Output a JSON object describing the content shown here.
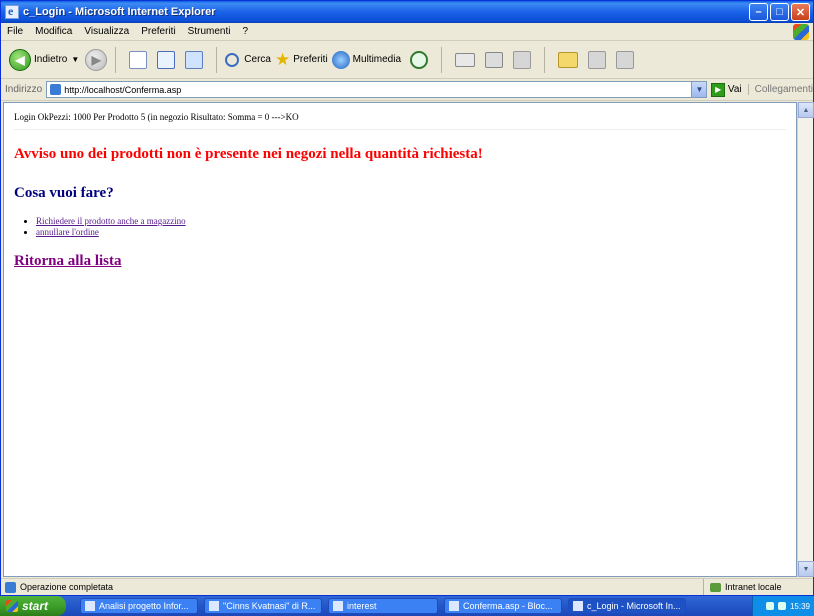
{
  "window": {
    "title": "c_Login - Microsoft Internet Explorer"
  },
  "menu": [
    "File",
    "Modifica",
    "Visualizza",
    "Preferiti",
    "Strumenti",
    "?"
  ],
  "toolbar": {
    "back_label": "Indietro",
    "search_label": "Cerca",
    "favorites_label": "Preferiti",
    "media_label": "Multimedia"
  },
  "address": {
    "label": "Indirizzo",
    "url": "http://localhost/Conferma.asp",
    "go_label": "Vai",
    "links_label": "Collegamenti"
  },
  "page": {
    "log_line": "Login OkPezzi: 1000 Per Prodotto 5 (in negozio Risultato: Somma = 0 --->KO",
    "warning": "Avviso uno dei prodotti non è presente nei negozi nella quantità richiesta!",
    "question": "Cosa vuoi fare?",
    "actions": [
      "Richiedere il prodotto anche a magazzino",
      "annullare l'ordine"
    ],
    "back_link": "Ritorna alla lista"
  },
  "status": {
    "text": "Operazione completata",
    "zone": "Intranet locale"
  },
  "taskbar": {
    "start_label": "start",
    "tasks": [
      "Analisi progetto Infor...",
      "\"Cinns Kvatnasi\" di R...",
      "interest",
      "Conferma.asp - Bloc...",
      "c_Login - Microsoft In..."
    ],
    "clock": "15:39"
  }
}
